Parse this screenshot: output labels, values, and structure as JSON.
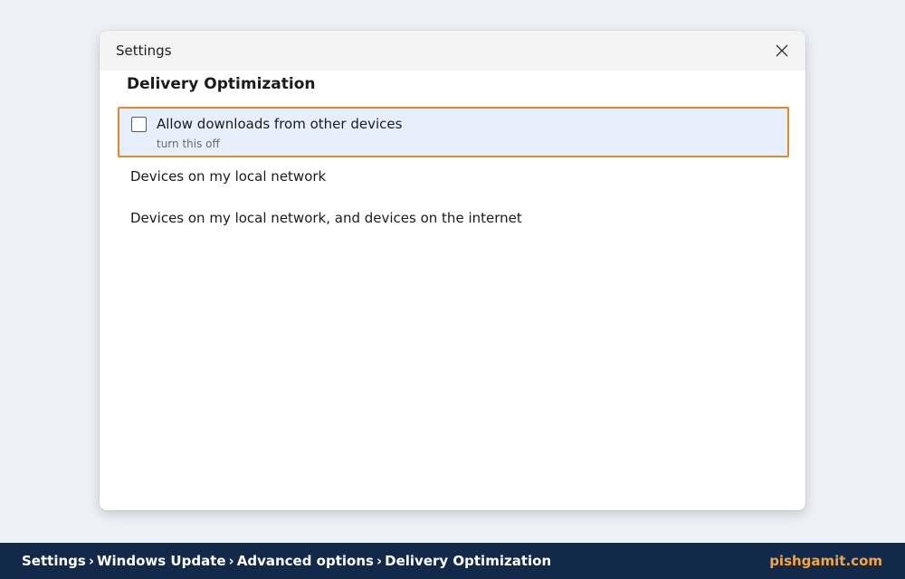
{
  "window": {
    "title": "Settings"
  },
  "section": {
    "heading": "Delivery Optimization",
    "toggle": {
      "label": "Allow downloads from other devices",
      "sublabel": "turn this off",
      "checked": false
    },
    "options": [
      "Devices on my local network",
      "Devices on my local network, and devices on the internet"
    ]
  },
  "footer": {
    "breadcrumb": [
      "Settings",
      "Windows Update",
      "Advanced options",
      "Delivery Optimization"
    ],
    "separator": "›",
    "brand": "pishgamit.com"
  },
  "colors": {
    "highlight_border": "#e08a2b",
    "highlight_fill": "#e6effb",
    "footer_bg": "#13294a",
    "brand": "#f5a53c"
  }
}
